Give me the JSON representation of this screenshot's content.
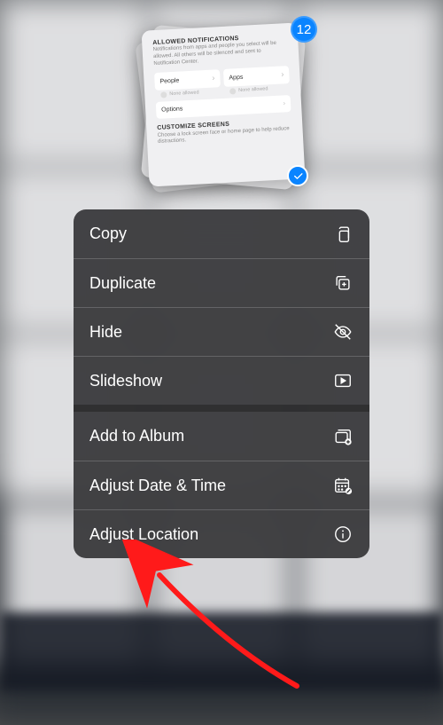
{
  "selection": {
    "count": "12",
    "preview": {
      "section1_title": "ALLOWED NOTIFICATIONS",
      "section1_desc": "Notifications from apps and people you select will be allowed. All others will be silenced and sent to Notification Center.",
      "people_label": "People",
      "apps_label": "Apps",
      "none_allowed": "None allowed",
      "options_label": "Options",
      "section2_title": "CUSTOMIZE SCREENS",
      "section2_desc": "Choose a lock screen face or home page to help reduce distractions."
    }
  },
  "menu": {
    "copy": "Copy",
    "duplicate": "Duplicate",
    "hide": "Hide",
    "slideshow": "Slideshow",
    "add_to_album": "Add to Album",
    "adjust_date_time": "Adjust Date & Time",
    "adjust_location": "Adjust Location"
  },
  "colors": {
    "accent": "#0a84ff",
    "annotation": "#ff1a1a"
  }
}
